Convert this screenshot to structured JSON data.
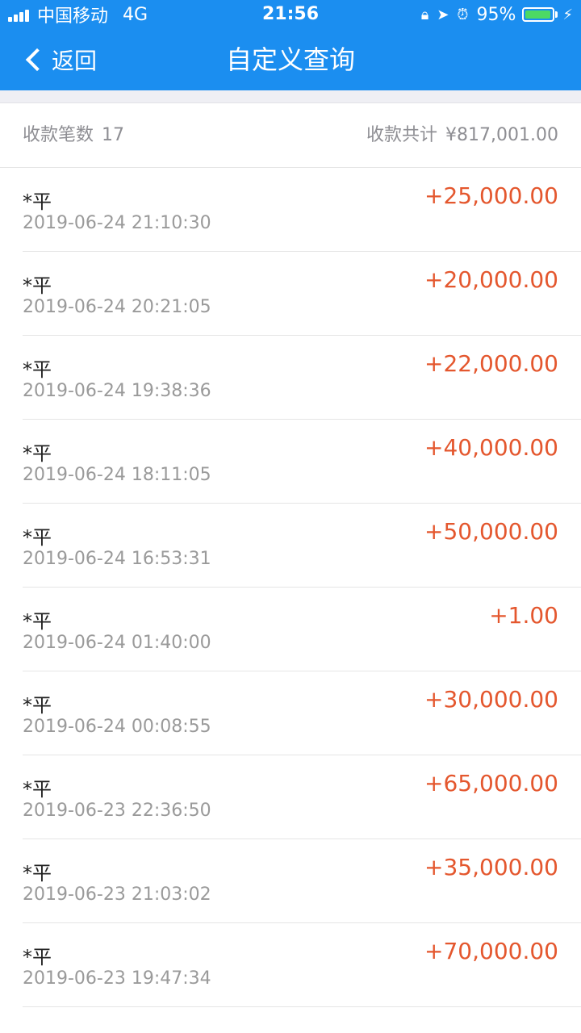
{
  "status_bar": {
    "carrier": "中国移动",
    "network": "4G",
    "time": "21:56",
    "battery_percent_text": "95%",
    "battery_level": 0.95,
    "icons": [
      "signal-icon",
      "orientation-lock-icon",
      "location-arrow-icon",
      "alarm-icon",
      "battery-icon",
      "charging-bolt-icon"
    ]
  },
  "nav": {
    "back_label": "返回",
    "title": "自定义查询"
  },
  "summary": {
    "count_label": "收款笔数",
    "count_value": "17",
    "total_label": "收款共计",
    "total_value": "¥817,001.00"
  },
  "transactions": [
    {
      "name": "*平",
      "time": "2019-06-24 21:10:30",
      "amount": "+25,000.00"
    },
    {
      "name": "*平",
      "time": "2019-06-24 20:21:05",
      "amount": "+20,000.00"
    },
    {
      "name": "*平",
      "time": "2019-06-24 19:38:36",
      "amount": "+22,000.00"
    },
    {
      "name": "*平",
      "time": "2019-06-24 18:11:05",
      "amount": "+40,000.00"
    },
    {
      "name": "*平",
      "time": "2019-06-24 16:53:31",
      "amount": "+50,000.00"
    },
    {
      "name": "*平",
      "time": "2019-06-24 01:40:00",
      "amount": "+1.00"
    },
    {
      "name": "*平",
      "time": "2019-06-24 00:08:55",
      "amount": "+30,000.00"
    },
    {
      "name": "*平",
      "time": "2019-06-23 22:36:50",
      "amount": "+65,000.00"
    },
    {
      "name": "*平",
      "time": "2019-06-23 21:03:02",
      "amount": "+35,000.00"
    },
    {
      "name": "*平",
      "time": "2019-06-23 19:47:34",
      "amount": "+70,000.00"
    }
  ],
  "colors": {
    "header_blue": "#1b8ef0",
    "amount_orange": "#e4572e",
    "battery_green": "#4cd964"
  }
}
